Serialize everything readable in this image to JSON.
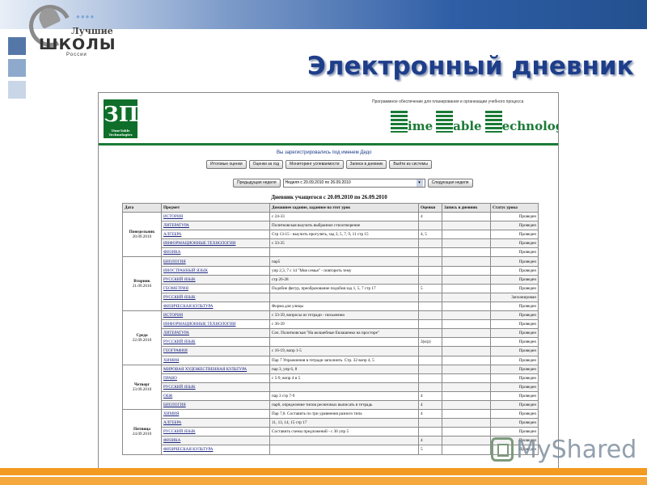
{
  "slide": {
    "title": "Электронный дневник",
    "logo": {
      "line1": "Лучшие",
      "line2": "ШКОЛЫ",
      "line3": "России"
    },
    "watermark": "MyShared",
    "colors": {
      "title": "#1e3e8a",
      "bottom_bar": "#f39a21",
      "top_bar": "#2f5ea6"
    }
  },
  "app": {
    "logo_text": "ЗП",
    "logo_caption": "TimeTable Technologies",
    "tagline": "Программное обеспечение для планирования и организации учебного процесса",
    "brand": {
      "w1": "ime",
      "w2": "able",
      "w3": "echnologies"
    },
    "registered_as": "Вы зарегистрировались под именем Дедо",
    "top_buttons": [
      "Итоговые оценки",
      "Оценки за год",
      "Мониторинг успеваемости",
      "Записи в дневник",
      "Выйти из системы"
    ],
    "week_nav": {
      "prev": "Предыдущая неделя",
      "select_value": "Неделя с 20.09.2010 по 26.09.2010",
      "next": "Следующая неделя"
    },
    "diary_title": "Дневник учащегося с 20.09.2010 по 26.09.2010",
    "columns": [
      "Дата",
      "Предмет",
      "Домашнее задание, заданное на этот урок",
      "Оценки",
      "Запись в дневник",
      "Статус урока"
    ],
    "days": [
      {
        "name": "Понедельник",
        "date": "20.09.2010",
        "lessons": [
          {
            "subject": "ИСТОРИЯ",
            "homework": "с 24-33",
            "grade": "4",
            "note": "",
            "status": "Проведен"
          },
          {
            "subject": "ЛИТЕРАТУРА",
            "homework": "Политковская выучить выбранное стихотворение",
            "grade": "",
            "note": "",
            "status": "Проведен"
          },
          {
            "subject": "АЛГЕБРА",
            "homework": "Стр 13-15 - выучить прогулять, зад 3, 5, 7, 9, 11 стр 15",
            "grade": "4, 5",
            "note": "",
            "status": "Проведен"
          },
          {
            "subject": "ИНФОРМАЦИОННЫЕ ТЕХНОЛОГИИ",
            "homework": "с 33-35",
            "grade": "",
            "note": "",
            "status": "Проведен"
          },
          {
            "subject": "ФИЗИКА",
            "homework": "",
            "grade": "",
            "note": "",
            "status": "Проведен"
          }
        ]
      },
      {
        "name": "Вторник",
        "date": "21.09.2010",
        "lessons": [
          {
            "subject": "БИОЛОГИЯ",
            "homework": "пар5",
            "grade": "",
            "note": "",
            "status": "Проведен"
          },
          {
            "subject": "ИНОСТРАННЫЙ ЯЗЫК",
            "homework": "упр 2,3, 7 с 14 \"Моя семья\" - повторить тему",
            "grade": "",
            "note": "",
            "status": "Проведен"
          },
          {
            "subject": "РУССКИЙ ЯЗЫК",
            "homework": "стр 26-28",
            "grade": "",
            "note": "",
            "status": "Проведен"
          },
          {
            "subject": "ГЕОМЕТРИЯ",
            "homework": "Подобие фигур, преобразование подобия зад 1, 5, 7 стр 17",
            "grade": "5",
            "note": "",
            "status": "Проведен"
          },
          {
            "subject": "РУССКИЙ ЯЗЫК",
            "homework": "",
            "grade": "",
            "note": "",
            "status": "Запланирован"
          },
          {
            "subject": "ФИЗИЧЕСКАЯ КУЛЬТУРА",
            "homework": "Форма для улицы",
            "grade": "",
            "note": "",
            "status": "Проведен"
          }
        ]
      },
      {
        "name": "Среда",
        "date": "22.09.2010",
        "lessons": [
          {
            "subject": "ИСТОРИЯ",
            "homework": "с 33-39, вопросы из тетради - письменно",
            "grade": "",
            "note": "",
            "status": "Проведен"
          },
          {
            "subject": "ИНФОРМАЦИОННЫЕ ТЕХНОЛОГИИ",
            "homework": "с 36-39",
            "grade": "",
            "note": "",
            "status": "Проведен"
          },
          {
            "subject": "ЛИТЕРАТУРА",
            "homework": "Соч. Политковская \"На волшебные Евлашенко на просторе\"",
            "grade": "",
            "note": "",
            "status": "Проведен"
          },
          {
            "subject": "РУССКИЙ ЯЗЫК",
            "homework": "",
            "grade": "3(к/р)",
            "note": "",
            "status": "Проведен"
          },
          {
            "subject": "ГЕОГРАФИЯ",
            "homework": "с 16-19, вопр 1-5",
            "grade": "",
            "note": "",
            "status": "Проведен"
          },
          {
            "subject": "ХИМИЯ",
            "homework": "Пар 7 Упражнения в тетради заполнить. Стр. 32 вопр 4, 5",
            "grade": "",
            "note": "",
            "status": "Проведен"
          }
        ]
      },
      {
        "name": "Четверг",
        "date": "23.09.2010",
        "lessons": [
          {
            "subject": "МИРОВАЯ ХУДОЖЕСТВЕННАЯ КУЛЬТУРА",
            "homework": "пар 3, упр 6, 8",
            "grade": "",
            "note": "",
            "status": "Проведен"
          },
          {
            "subject": "ПРАВО",
            "homework": "с 5-9, вопр 4 и 5",
            "grade": "",
            "note": "",
            "status": "Проведен"
          },
          {
            "subject": "РУССКИЙ ЯЗЫК",
            "homework": "",
            "grade": "",
            "note": "",
            "status": "Проведен"
          },
          {
            "subject": "ОБЖ",
            "homework": "пар 3 стр 7-9",
            "grade": "4",
            "note": "",
            "status": "Проведен"
          },
          {
            "subject": "БИОЛОГИЯ",
            "homework": "пар6, определение типов ресничных выписать в тетрадь",
            "grade": "4",
            "note": "",
            "status": "Проведен"
          }
        ]
      },
      {
        "name": "Пятница",
        "date": "24.09.2010",
        "lessons": [
          {
            "subject": "ХИМИЯ",
            "homework": "Пар 7,8. Составить по три уравнения разного типа",
            "grade": "4",
            "note": "",
            "status": "Проведен"
          },
          {
            "subject": "АЛГЕБРА",
            "homework": "11, 13, 14, 15 стр 17",
            "grade": "",
            "note": "",
            "status": "Проведен"
          },
          {
            "subject": "РУССКИЙ ЯЗЫК",
            "homework": "Составить схемы предложений - с 36 упр 5",
            "grade": "",
            "note": "",
            "status": "Проведен"
          },
          {
            "subject": "ФИЗИКА",
            "homework": "",
            "grade": "4",
            "note": "",
            "status": "Проведен"
          },
          {
            "subject": "ФИЗИЧЕСКАЯ КУЛЬТУРА",
            "homework": "",
            "grade": "5",
            "note": "",
            "status": "Проведен"
          }
        ]
      }
    ]
  }
}
